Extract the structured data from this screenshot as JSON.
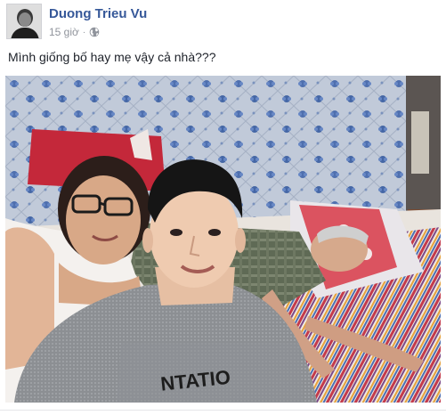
{
  "post": {
    "author": "Duong Trieu Vu",
    "timestamp": "15 giờ",
    "separator": "·",
    "privacy_icon": "globe-icon",
    "text": "Mình giống bố hay mẹ vậy cả nhà???",
    "photo_description_icon": "photo"
  },
  "colors": {
    "author_link": "#365899",
    "meta_text": "#90949c",
    "body_text": "#1d2129"
  }
}
